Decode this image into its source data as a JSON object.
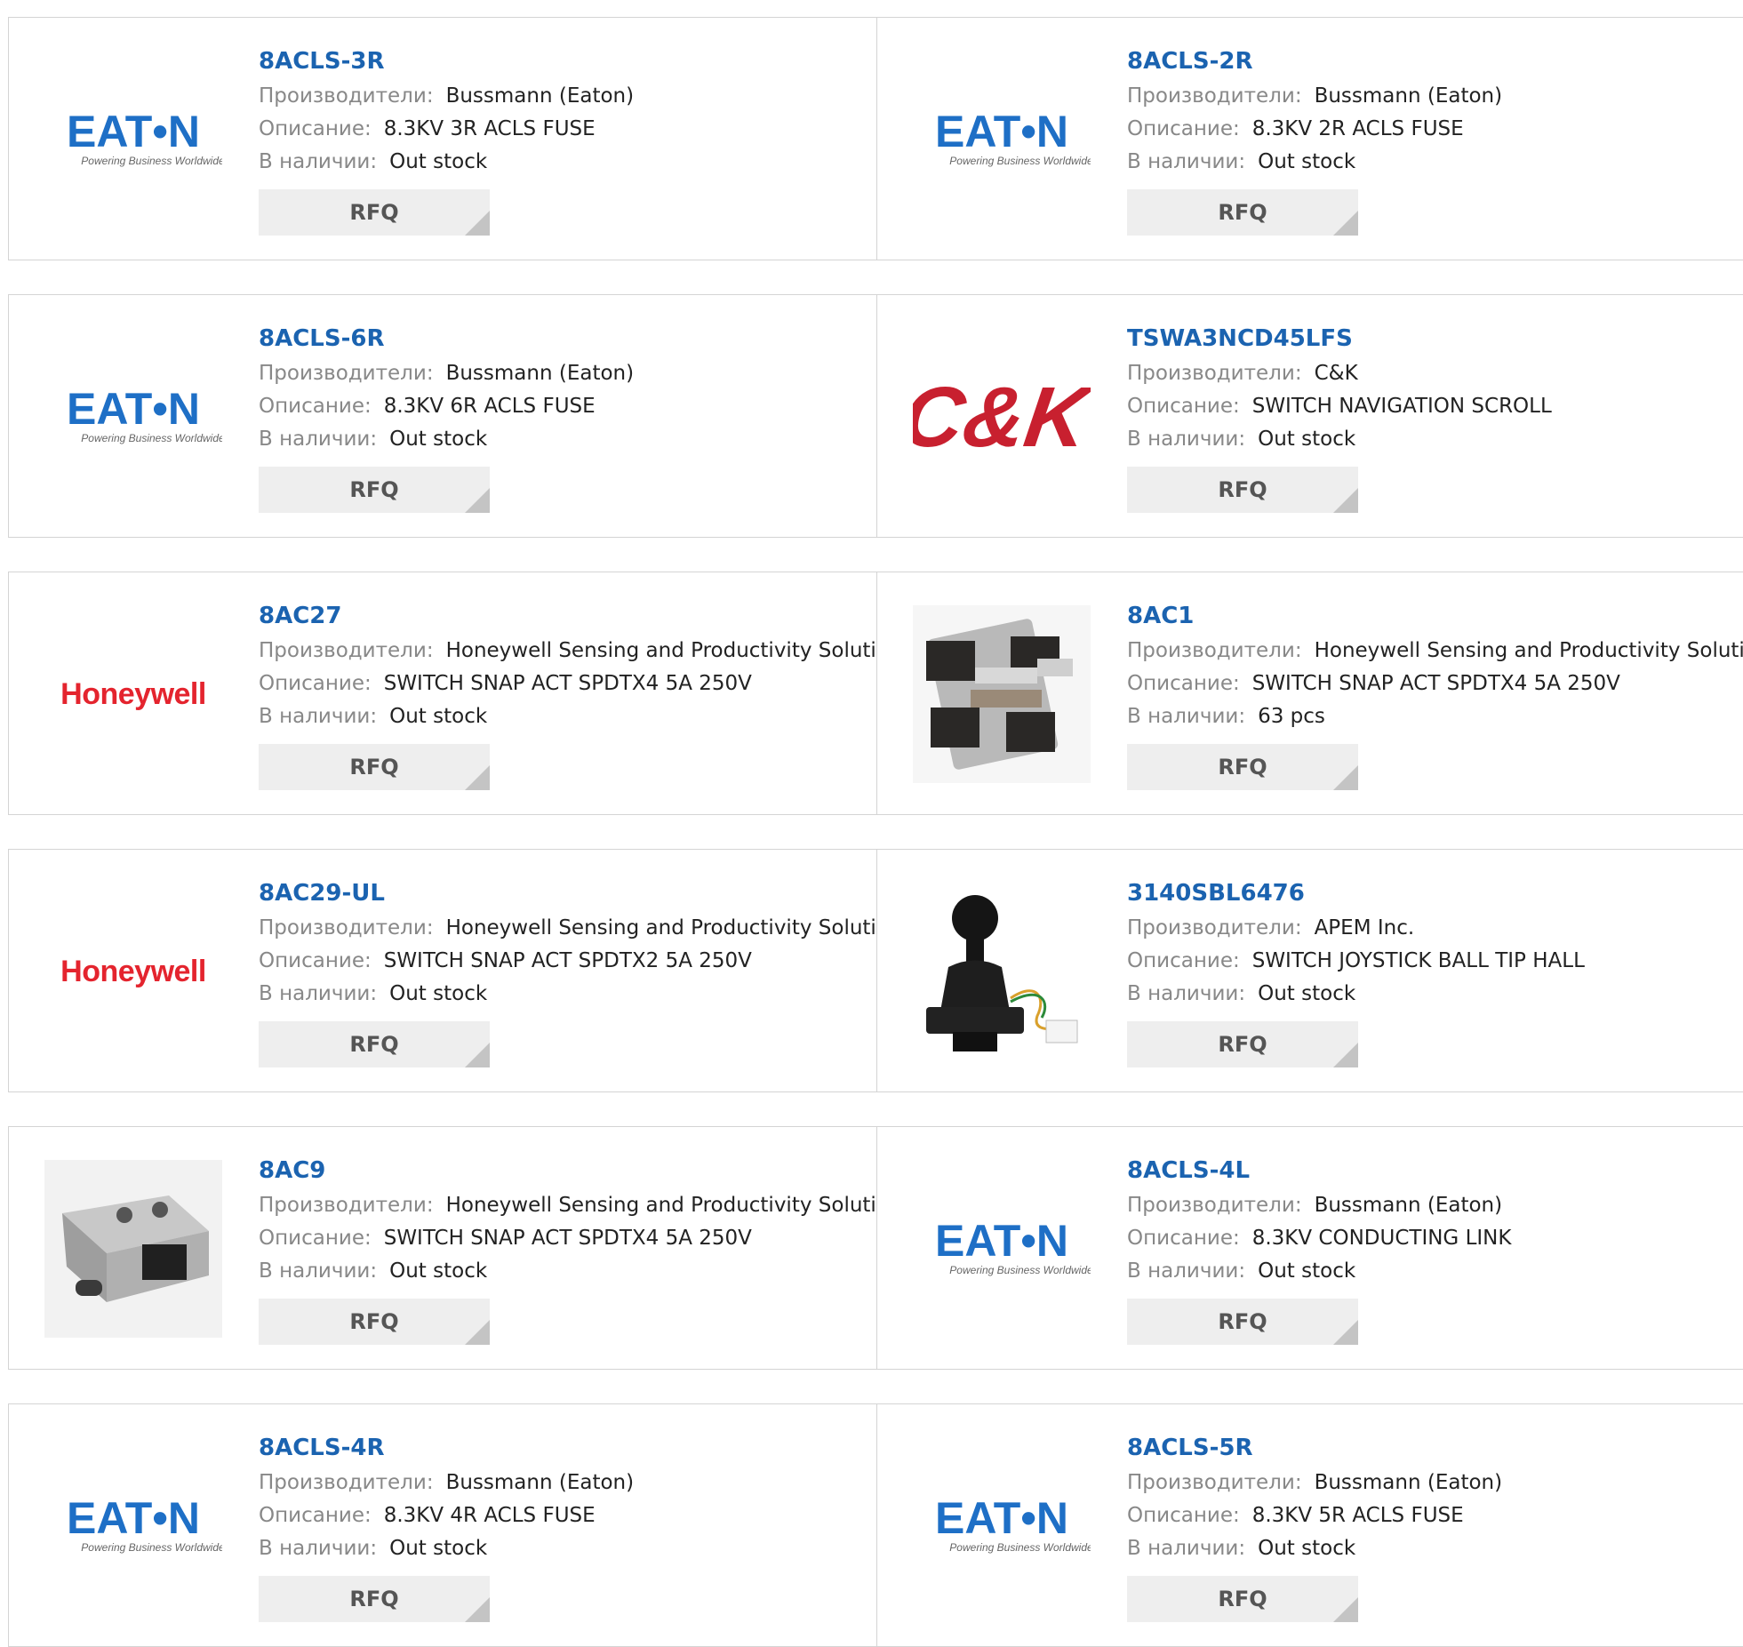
{
  "labels": {
    "manufacturer": "Производители:",
    "description": "Описание:",
    "stock": "В наличии:",
    "rfq": "RFQ"
  },
  "logos": {
    "eaton_text": "EAT•N",
    "eaton_tagline": "Powering Business Worldwide",
    "ck_text": "C&K",
    "honeywell_text": "Honeywell"
  },
  "colors": {
    "link": "#1b63b0",
    "eaton_blue": "#1e6fc6",
    "honeywell_red": "#e4242e",
    "ck_red": "#c8202f",
    "rfq_bg": "#eeeeee"
  },
  "products": [
    {
      "part": "8ACLS-3R",
      "manufacturer": "Bussmann (Eaton)",
      "description": "8.3KV 3R ACLS FUSE",
      "stock": "Out stock",
      "logo": "eaton"
    },
    {
      "part": "8ACLS-2R",
      "manufacturer": "Bussmann (Eaton)",
      "description": "8.3KV 2R ACLS FUSE",
      "stock": "Out stock",
      "logo": "eaton"
    },
    {
      "part": "8ACLS-6R",
      "manufacturer": "Bussmann (Eaton)",
      "description": "8.3KV 6R ACLS FUSE",
      "stock": "Out stock",
      "logo": "eaton"
    },
    {
      "part": "TSWA3NCD45LFS",
      "manufacturer": "C&K",
      "description": "SWITCH NAVIGATION SCROLL",
      "stock": "Out stock",
      "logo": "ck"
    },
    {
      "part": "8AC27",
      "manufacturer": "Honeywell Sensing and Productivity Solutions",
      "description": "SWITCH SNAP ACT SPDTX4 5A 250V",
      "stock": "Out stock",
      "logo": "honeywell"
    },
    {
      "part": "8AC1",
      "manufacturer": "Honeywell Sensing and Productivity Solutions",
      "description": "SWITCH SNAP ACT SPDTX4 5A 250V",
      "stock": "63 pcs",
      "logo": "photo-snap-switch"
    },
    {
      "part": "8AC29-UL",
      "manufacturer": "Honeywell Sensing and Productivity Solutions",
      "description": "SWITCH SNAP ACT SPDTX2 5A 250V",
      "stock": "Out stock",
      "logo": "honeywell"
    },
    {
      "part": "3140SBL6476",
      "manufacturer": "APEM Inc.",
      "description": "SWITCH JOYSTICK BALL TIP HALL",
      "stock": "Out stock",
      "logo": "photo-joystick"
    },
    {
      "part": "8AC9",
      "manufacturer": "Honeywell Sensing and Productivity Solutions",
      "description": "SWITCH SNAP ACT SPDTX4 5A 250V",
      "stock": "Out stock",
      "logo": "photo-switch-plate"
    },
    {
      "part": "8ACLS-4L",
      "manufacturer": "Bussmann (Eaton)",
      "description": "8.3KV CONDUCTING LINK",
      "stock": "Out stock",
      "logo": "eaton"
    },
    {
      "part": "8ACLS-4R",
      "manufacturer": "Bussmann (Eaton)",
      "description": "8.3KV 4R ACLS FUSE",
      "stock": "Out stock",
      "logo": "eaton"
    },
    {
      "part": "8ACLS-5R",
      "manufacturer": "Bussmann (Eaton)",
      "description": "8.3KV 5R ACLS FUSE",
      "stock": "Out stock",
      "logo": "eaton"
    }
  ]
}
